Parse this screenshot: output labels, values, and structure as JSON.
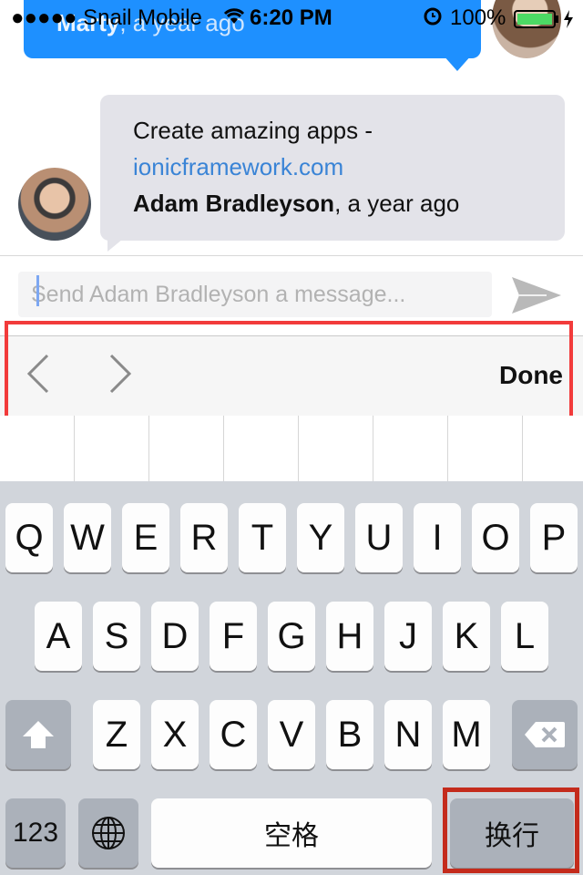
{
  "status_bar": {
    "carrier": "●●●●● Snail Mobile",
    "time": "6:20 PM",
    "battery": "100%",
    "icons": [
      "wifi-icon",
      "alarm-icon",
      "battery-icon",
      "charging-icon"
    ]
  },
  "messages": [
    {
      "author": "Marty",
      "time_ago": ", a year ago"
    },
    {
      "text": "Create amazing apps -",
      "link": "ionicframework.com",
      "author": "Adam Bradleyson",
      "time_ago": ", a year ago"
    }
  ],
  "compose": {
    "placeholder": "Send Adam Bradleyson a message...",
    "send_icon": "send-icon"
  },
  "accessory_bar": {
    "prev_icon": "chevron-left-icon",
    "next_icon": "chevron-right-icon",
    "done_label": "Done"
  },
  "keyboard": {
    "row1": [
      "Q",
      "W",
      "E",
      "R",
      "T",
      "Y",
      "U",
      "I",
      "O",
      "P"
    ],
    "row2": [
      "A",
      "S",
      "D",
      "F",
      "G",
      "H",
      "J",
      "K",
      "L"
    ],
    "row3": [
      "Z",
      "X",
      "C",
      "V",
      "B",
      "N",
      "M"
    ],
    "shift_icon": "shift-icon",
    "backspace_icon": "backspace-icon",
    "numbers_label": "123",
    "globe_icon": "globe-icon",
    "space_label": "空格",
    "return_label": "换行"
  },
  "colors": {
    "accent_blue": "#1e90ff",
    "link": "#3a84d6",
    "highlight_red": "#f23b3b"
  }
}
